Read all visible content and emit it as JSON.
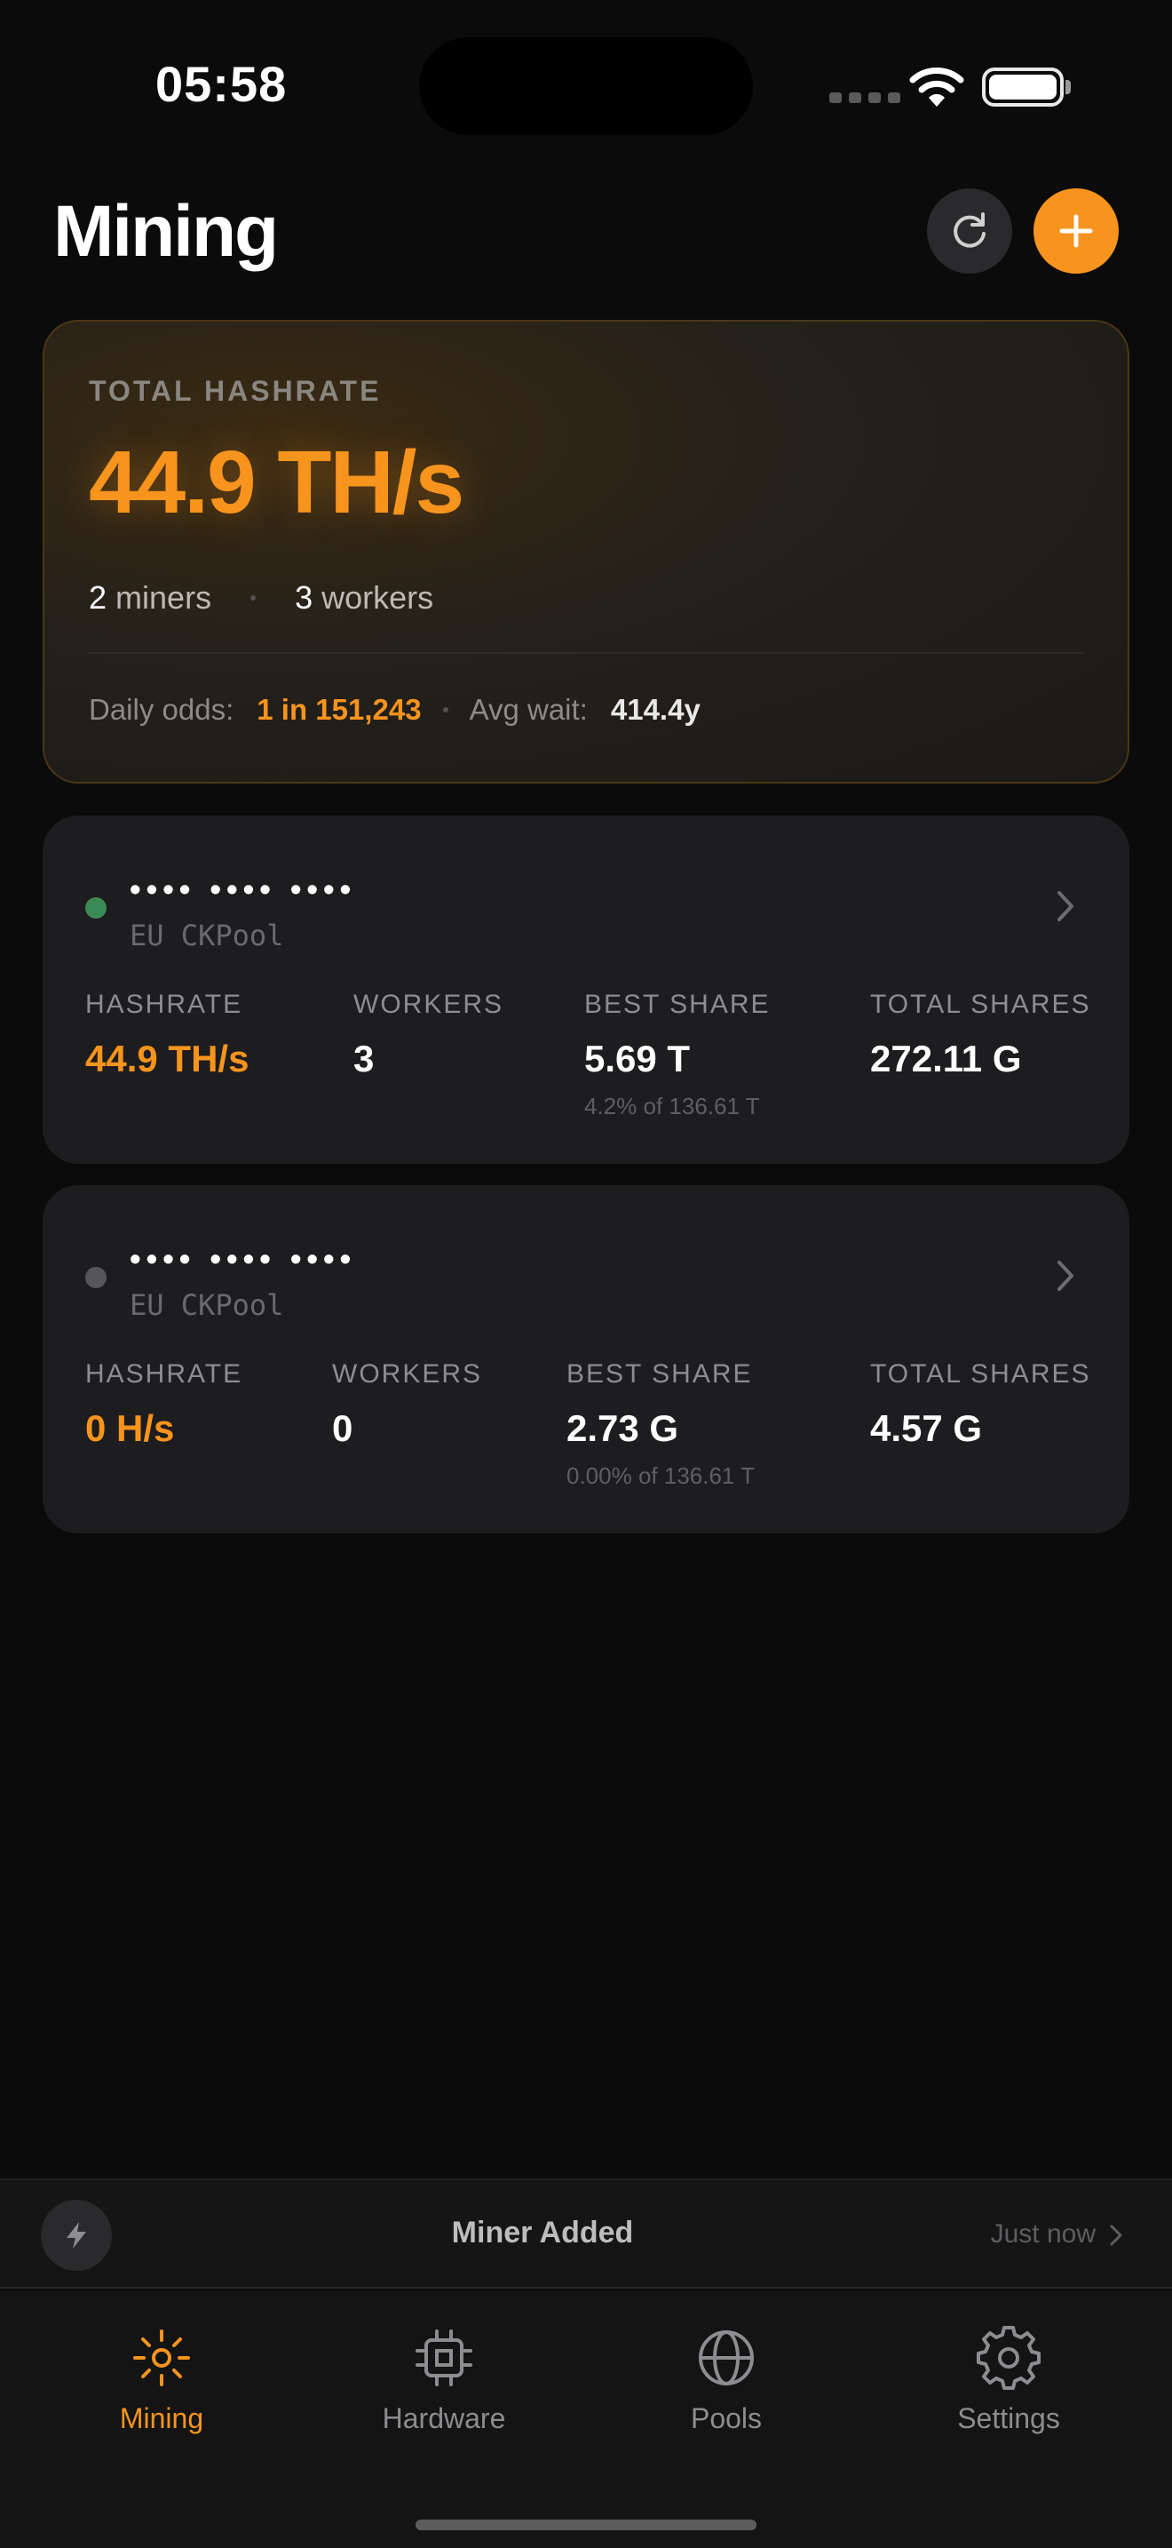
{
  "status_bar": {
    "time": "05:58"
  },
  "header": {
    "title": "Mining"
  },
  "summary": {
    "label": "TOTAL HASHRATE",
    "hashrate": "44.9 TH/s",
    "miners_count": "2",
    "miners_label": "miners",
    "workers_count": "3",
    "workers_label": "workers",
    "odds_label": "Daily odds:",
    "odds_value": "1 in 151,243",
    "wait_label": "Avg wait:",
    "wait_value": "414.4y"
  },
  "miners": [
    {
      "name": "•••• •••• ••••",
      "pool": "EU CKPool",
      "status_color": "#3a8a55",
      "hashrate_label": "HASHRATE",
      "hashrate": "44.9 TH/s",
      "workers_label": "WORKERS",
      "workers": "3",
      "best_share_label": "BEST SHARE",
      "best_share": "5.69 T",
      "best_share_sub": "4.2% of 136.61 T",
      "total_shares_label": "TOTAL SHARES",
      "total_shares": "272.11 G"
    },
    {
      "name": "•••• •••• ••••",
      "pool": "EU CKPool",
      "status_color": "#56565a",
      "hashrate_label": "HASHRATE",
      "hashrate": "0 H/s",
      "workers_label": "WORKERS",
      "workers": "0",
      "best_share_label": "BEST SHARE",
      "best_share": "2.73 G",
      "best_share_sub": "0.00% of 136.61 T",
      "total_shares_label": "TOTAL SHARES",
      "total_shares": "4.57 G"
    }
  ],
  "toast": {
    "title": "Miner Added",
    "time": "Just now",
    "icon": "bolt-icon"
  },
  "tabs": [
    {
      "label": "Mining",
      "icon": "sun-icon",
      "active": true
    },
    {
      "label": "Hardware",
      "icon": "chip-icon",
      "active": false
    },
    {
      "label": "Pools",
      "icon": "globe-icon",
      "active": false
    },
    {
      "label": "Settings",
      "icon": "gear-icon",
      "active": false
    }
  ],
  "colors": {
    "accent": "#f7941d",
    "background": "#0b0b0b",
    "card": "#1d1d1f"
  }
}
